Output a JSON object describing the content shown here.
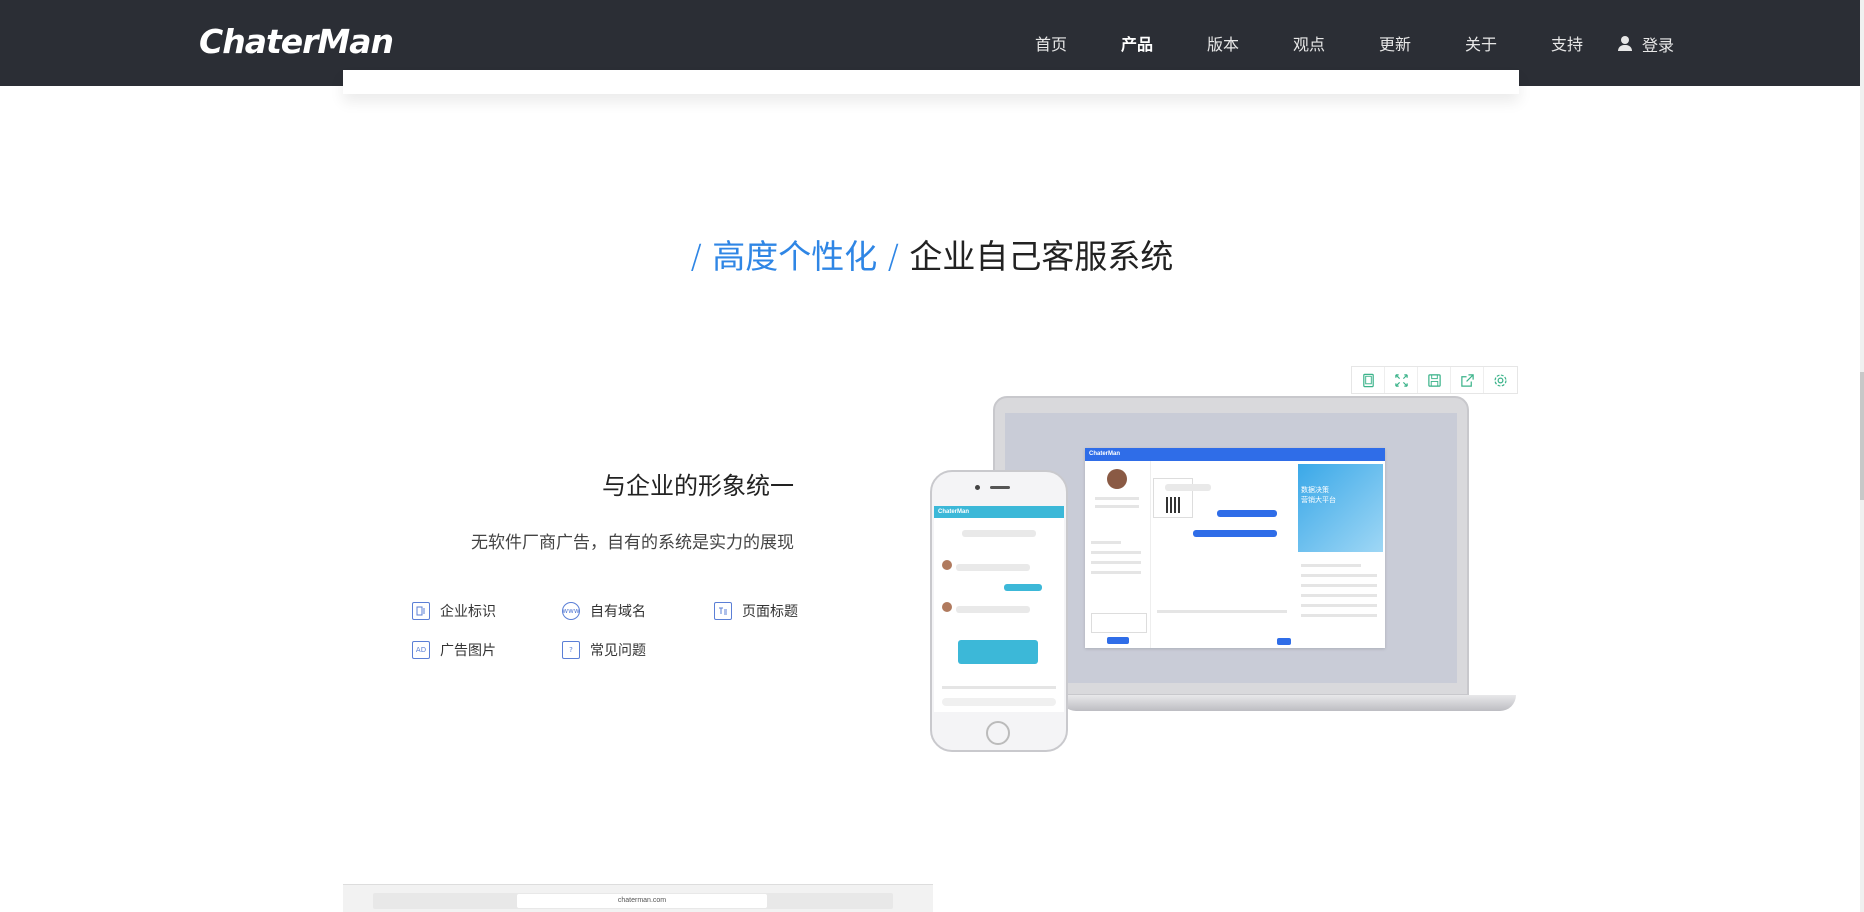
{
  "nav": {
    "logo": "ChaterMan",
    "items": [
      {
        "label": "首页",
        "active": false
      },
      {
        "label": "产品",
        "active": true
      },
      {
        "label": "版本",
        "active": false
      },
      {
        "label": "观点",
        "active": false
      },
      {
        "label": "更新",
        "active": false
      },
      {
        "label": "关于",
        "active": false
      },
      {
        "label": "支持",
        "active": false
      }
    ],
    "login": "登录"
  },
  "section": {
    "slash1": "/",
    "highlight": "高度个性化",
    "slash2": "/",
    "rest": "企业自己客服系统"
  },
  "feature": {
    "heading": "与企业的形象统一",
    "desc": "无软件厂商广告，自有的系统是实力的展现",
    "items": [
      {
        "label": "企业标识",
        "icon": "id-card-icon"
      },
      {
        "label": "自有域名",
        "icon": "www-icon"
      },
      {
        "label": "页面标题",
        "icon": "title-icon"
      },
      {
        "label": "广告图片",
        "icon": "ad-image-icon"
      },
      {
        "label": "常见问题",
        "icon": "faq-icon"
      }
    ]
  },
  "toolbar": {
    "buttons": [
      "tablet-icon",
      "fullscreen-icon",
      "save-icon",
      "share-icon",
      "settings-icon"
    ]
  },
  "mockup": {
    "app_title": "ChaterMan",
    "ad_line1": "数据决策",
    "ad_line2": "营销大平台",
    "phone_title": "ChaterMan"
  },
  "browser": {
    "url": "chaterman.com"
  },
  "colors": {
    "nav_bg": "#2b2e35",
    "accent": "#2f86e5",
    "icon_green": "#3bb38a"
  }
}
